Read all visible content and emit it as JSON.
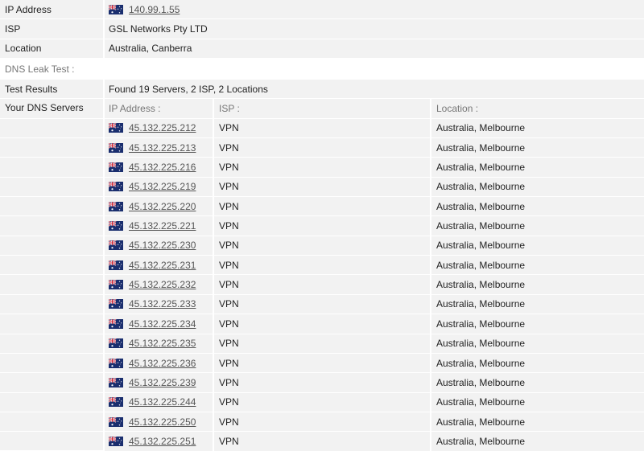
{
  "ip_info": {
    "ip_label": "IP Address",
    "ip_value": "140.99.1.55",
    "isp_label": "ISP",
    "isp_value": "GSL Networks Pty LTD",
    "location_label": "Location",
    "location_value": "Australia, Canberra"
  },
  "dns_leak": {
    "section_title": "DNS Leak Test :",
    "results_label": "Test Results",
    "results_value": "Found 19 Servers, 2 ISP, 2 Locations",
    "servers_label": "Your DNS Servers",
    "columns": {
      "ip": "IP Address :",
      "isp": "ISP :",
      "location": "Location :"
    },
    "servers": [
      {
        "ip": "45.132.225.212",
        "isp": "VPN",
        "location": "Australia, Melbourne"
      },
      {
        "ip": "45.132.225.213",
        "isp": "VPN",
        "location": "Australia, Melbourne"
      },
      {
        "ip": "45.132.225.216",
        "isp": "VPN",
        "location": "Australia, Melbourne"
      },
      {
        "ip": "45.132.225.219",
        "isp": "VPN",
        "location": "Australia, Melbourne"
      },
      {
        "ip": "45.132.225.220",
        "isp": "VPN",
        "location": "Australia, Melbourne"
      },
      {
        "ip": "45.132.225.221",
        "isp": "VPN",
        "location": "Australia, Melbourne"
      },
      {
        "ip": "45.132.225.230",
        "isp": "VPN",
        "location": "Australia, Melbourne"
      },
      {
        "ip": "45.132.225.231",
        "isp": "VPN",
        "location": "Australia, Melbourne"
      },
      {
        "ip": "45.132.225.232",
        "isp": "VPN",
        "location": "Australia, Melbourne"
      },
      {
        "ip": "45.132.225.233",
        "isp": "VPN",
        "location": "Australia, Melbourne"
      },
      {
        "ip": "45.132.225.234",
        "isp": "VPN",
        "location": "Australia, Melbourne"
      },
      {
        "ip": "45.132.225.235",
        "isp": "VPN",
        "location": "Australia, Melbourne"
      },
      {
        "ip": "45.132.225.236",
        "isp": "VPN",
        "location": "Australia, Melbourne"
      },
      {
        "ip": "45.132.225.239",
        "isp": "VPN",
        "location": "Australia, Melbourne"
      },
      {
        "ip": "45.132.225.244",
        "isp": "VPN",
        "location": "Australia, Melbourne"
      },
      {
        "ip": "45.132.225.250",
        "isp": "VPN",
        "location": "Australia, Melbourne"
      },
      {
        "ip": "45.132.225.251",
        "isp": "VPN",
        "location": "Australia, Melbourne"
      }
    ]
  },
  "flag_icon": "australia-flag-icon",
  "colors": {
    "row_bg": "#f2f2f2",
    "link": "#555555",
    "text": "#222222",
    "muted": "#777777"
  }
}
